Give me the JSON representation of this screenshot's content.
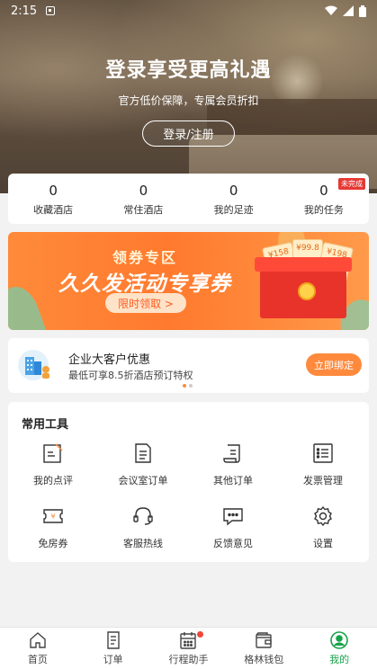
{
  "status_bar": {
    "time": "2:15"
  },
  "hero": {
    "title": "登录享受更高礼遇",
    "subtitle": "官方低价保障，专属会员折扣",
    "login_button": "登录/注册"
  },
  "stats": [
    {
      "count": "0",
      "label": "收藏酒店"
    },
    {
      "count": "0",
      "label": "常住酒店"
    },
    {
      "count": "0",
      "label": "我的足迹"
    },
    {
      "count": "0",
      "label": "我的任务",
      "badge": "未完成"
    }
  ],
  "banner": {
    "tag": "领券专区",
    "title": "久久发活动专享券",
    "button": "限时领取 >",
    "coupons": [
      "¥158",
      "¥99.8",
      "¥198"
    ]
  },
  "corporate": {
    "title": "企业大客户优惠",
    "subtitle": "最低可享8.5折酒店预订特权",
    "button": "立即绑定"
  },
  "tools": {
    "title": "常用工具",
    "items": [
      {
        "label": "我的点评",
        "icon": "edit-note-icon"
      },
      {
        "label": "会议室订单",
        "icon": "document-icon"
      },
      {
        "label": "其他订单",
        "icon": "scroll-icon"
      },
      {
        "label": "发票管理",
        "icon": "invoice-icon"
      },
      {
        "label": "免房券",
        "icon": "voucher-icon"
      },
      {
        "label": "客服热线",
        "icon": "headset-icon"
      },
      {
        "label": "反馈意见",
        "icon": "feedback-icon"
      },
      {
        "label": "设置",
        "icon": "gear-icon"
      }
    ]
  },
  "bottom_nav": [
    {
      "label": "首页",
      "icon": "home-icon"
    },
    {
      "label": "订单",
      "icon": "order-icon"
    },
    {
      "label": "行程助手",
      "icon": "calendar-icon"
    },
    {
      "label": "格林钱包",
      "icon": "wallet-icon"
    },
    {
      "label": "我的",
      "icon": "profile-icon"
    }
  ],
  "colors": {
    "accent": "#ff8a3d",
    "active_nav": "#18a34a",
    "badge": "#e53935"
  }
}
